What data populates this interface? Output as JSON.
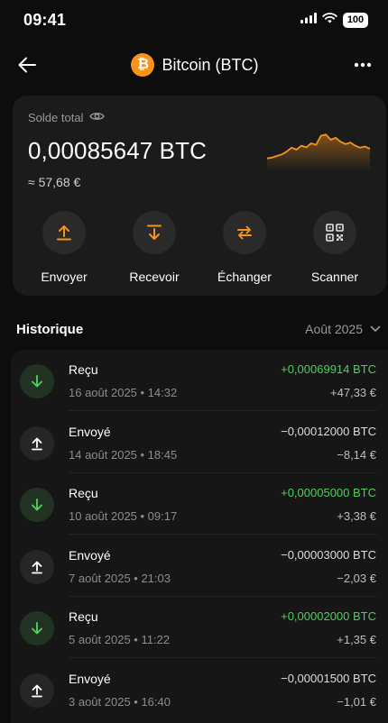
{
  "status_bar": {
    "time": "09:41",
    "battery": "100"
  },
  "header": {
    "title": "Bitcoin (BTC)",
    "logo_symbol": "₿"
  },
  "balance": {
    "label": "Solde total",
    "amount": "0,00085647 BTC",
    "fiat": "≈ 57,68 €",
    "sparkline_values": [
      0.28,
      0.3,
      0.34,
      0.38,
      0.45,
      0.55,
      0.5,
      0.6,
      0.56,
      0.66,
      0.62,
      0.85,
      0.88,
      0.75,
      0.8,
      0.7,
      0.64,
      0.68,
      0.6,
      0.55,
      0.58,
      0.52
    ]
  },
  "actions": [
    {
      "label": "Envoyer",
      "icon": "send-up-icon"
    },
    {
      "label": "Recevoir",
      "icon": "receive-down-icon"
    },
    {
      "label": "Échanger",
      "icon": "swap-icon"
    },
    {
      "label": "Scanner",
      "icon": "qr-scan-icon"
    }
  ],
  "history": {
    "title": "Historique",
    "period": "Août 2025",
    "transactions": [
      {
        "type": "Reçu",
        "direction": "in",
        "date": "16 août 2025 • 14:32",
        "amount": "+0,00069914 BTC",
        "fiat": "+47,33 €"
      },
      {
        "type": "Envoyé",
        "direction": "out",
        "date": "14 août 2025 • 18:45",
        "amount": "−0,00012000 BTC",
        "fiat": "−8,14 €"
      },
      {
        "type": "Reçu",
        "direction": "in",
        "date": "10 août 2025 • 09:17",
        "amount": "+0,00005000 BTC",
        "fiat": "+3,38 €"
      },
      {
        "type": "Envoyé",
        "direction": "out",
        "date": "7 août 2025 • 21:03",
        "amount": "−0,00003000 BTC",
        "fiat": "−2,03 €"
      },
      {
        "type": "Reçu",
        "direction": "in",
        "date": "5 août 2025 • 11:22",
        "amount": "+0,00002000 BTC",
        "fiat": "+1,35 €"
      },
      {
        "type": "Envoyé",
        "direction": "out",
        "date": "3 août 2025 • 16:40",
        "amount": "−0,00001500 BTC",
        "fiat": "−1,01 €"
      }
    ]
  },
  "colors": {
    "accent": "#f7931a",
    "positive": "#4fcf5a",
    "background": "#0d0d0d",
    "card": "#1b1b1b"
  }
}
